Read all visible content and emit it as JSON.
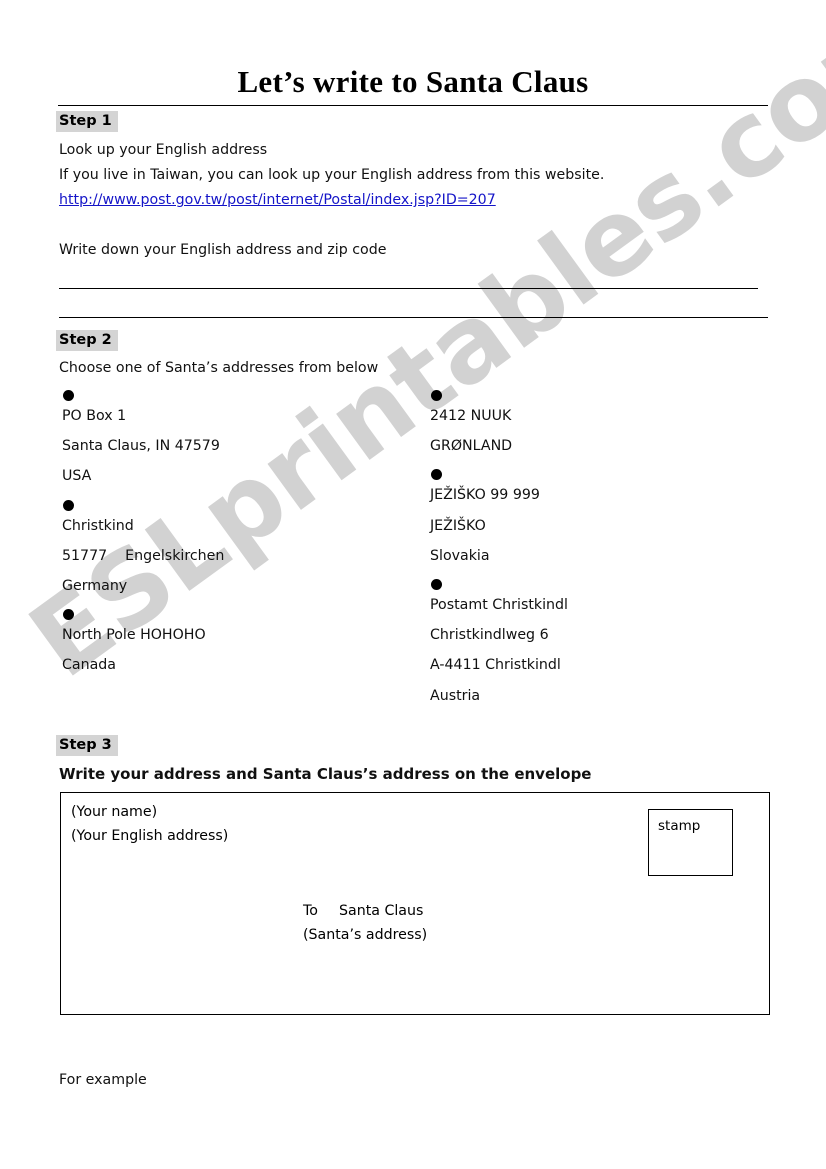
{
  "document": {
    "title": "Let’s write to Santa Claus",
    "watermark": "ESLprintables.com",
    "footer_note": "For example"
  },
  "colors": {
    "step_highlight": "#d4d4d4",
    "link": "#1414c8",
    "watermark": "#d2d2d2",
    "rule": "#000000"
  },
  "steps": [
    {
      "label": "Step 1",
      "lines": [
        "Look up your English address",
        "If you live in Taiwan, you can look up your English address from this website."
      ],
      "link": "http://www.post.gov.tw/post/internet/Postal/index.jsp?ID=207",
      "prompt": "Write down your English address and zip code",
      "blank_lines": 2
    },
    {
      "label": "Step 2",
      "instruction": "Choose one of Santa’s addresses from below"
    },
    {
      "label": "Step 3",
      "instruction": "Write your address and Santa Claus’s address on the envelope"
    }
  ],
  "addresses": {
    "left_column": [
      {
        "lines": [
          "PO Box 1",
          "Santa Claus, IN 47579",
          "USA"
        ]
      },
      {
        "lines": [
          "Christkind",
          "51777    Engelskirchen",
          "Germany"
        ]
      },
      {
        "lines": [
          "North Pole HOHOHO",
          "Canada"
        ]
      }
    ],
    "right_column": [
      {
        "lines": [
          "2412 NUUK",
          "GRØNLAND"
        ]
      },
      {
        "lines": [
          "JEŽIŠKO 99 999",
          "JEŽIŠKO",
          "Slovakia"
        ]
      },
      {
        "lines": [
          "Postamt Christkindl",
          "Christkindlweg 6",
          "A-4411 Christkindl",
          "Austria"
        ]
      }
    ]
  },
  "envelope": {
    "sender_name": "(Your name)",
    "sender_address": "(Your English address)",
    "to_prefix": "To",
    "to_name": "Santa Claus",
    "to_address": "(Santa’s address)",
    "stamp_label": "stamp"
  }
}
